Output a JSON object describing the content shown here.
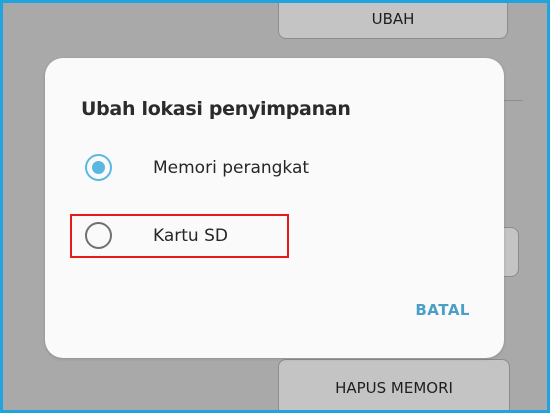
{
  "background": {
    "top_button_label": "UBAH",
    "bottom_button_label": "HAPUS MEMORI"
  },
  "dialog": {
    "title": "Ubah lokasi penyimpanan",
    "options": [
      {
        "label": "Memori perangkat",
        "selected": true
      },
      {
        "label": "Kartu SD",
        "selected": false
      }
    ],
    "cancel_label": "BATAL"
  },
  "colors": {
    "accent": "#5ab8e0",
    "cancel_text": "#4a9fc7",
    "highlight": "#e51a1a",
    "frame_border": "#20a4dd",
    "dim_overlay": "#a9a9a9"
  }
}
